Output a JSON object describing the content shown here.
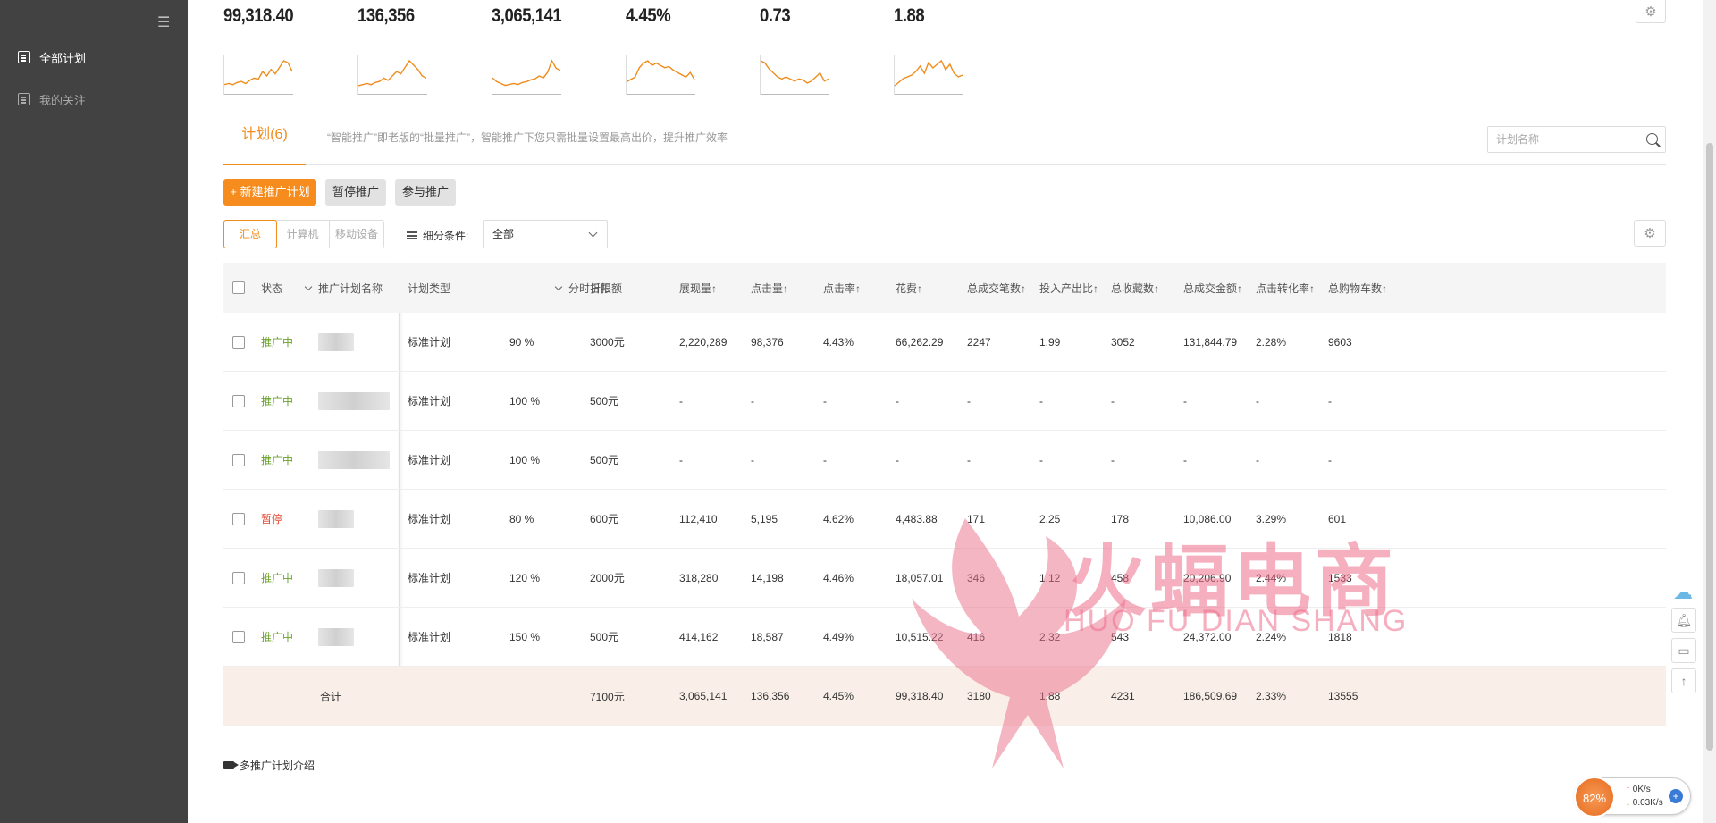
{
  "sidebar": {
    "collapse_icon": "menu-collapse-icon",
    "items": [
      {
        "label": "全部计划",
        "icon": "document-icon",
        "active": true
      },
      {
        "label": "我的关注",
        "icon": "follow-icon",
        "active": false
      }
    ]
  },
  "metrics": [
    {
      "value": "99,318.40",
      "trend": [
        6,
        7,
        6,
        8,
        9,
        7,
        10,
        12,
        11,
        18,
        14,
        20,
        16,
        22,
        28,
        26,
        18
      ]
    },
    {
      "value": "136,356",
      "trend": [
        5,
        6,
        7,
        6,
        8,
        9,
        12,
        10,
        14,
        18,
        16,
        22,
        28,
        24,
        20,
        14,
        12
      ]
    },
    {
      "value": "3,065,141",
      "trend": [
        14,
        10,
        8,
        6,
        7,
        8,
        7,
        9,
        10,
        12,
        13,
        16,
        14,
        20,
        32,
        24,
        22
      ]
    },
    {
      "value": "4.45%",
      "trend": [
        8,
        10,
        12,
        20,
        24,
        26,
        22,
        24,
        22,
        20,
        21,
        18,
        16,
        14,
        12,
        16,
        10
      ]
    },
    {
      "value": "0.73",
      "trend": [
        30,
        28,
        22,
        18,
        14,
        12,
        14,
        12,
        10,
        12,
        11,
        8,
        10,
        14,
        18,
        10,
        12
      ]
    },
    {
      "value": "1.88",
      "trend": [
        6,
        10,
        14,
        16,
        18,
        22,
        28,
        20,
        32,
        26,
        30,
        34,
        24,
        30,
        20,
        16,
        18
      ]
    }
  ],
  "tabs": {
    "active_label": "计划(6)",
    "tip": "“智能推广”即老版的“批量推广”，智能推广下您只需批量设置最高出价，提升推广效率"
  },
  "search": {
    "placeholder": "计划名称"
  },
  "toolbar": {
    "new_plan": "+ 新建推广计划",
    "pause": "暂停推广",
    "join": "参与推广"
  },
  "device_tabs": [
    "汇总",
    "计算机",
    "移动设备"
  ],
  "filter": {
    "label": "细分条件:",
    "selected": "全部"
  },
  "table": {
    "headers": {
      "status": "状态",
      "name": "推广计划名称",
      "type": "计划类型",
      "discount": "分时折扣",
      "budget": "日限额",
      "impressions": "展现量↑",
      "clicks": "点击量↑",
      "ctr": "点击率↑",
      "cost": "花费↑",
      "orders": "总成交笔数↑",
      "roi": "投入产出比↑",
      "favs": "总收藏数↑",
      "gmv": "总成交金额↑",
      "cvr": "点击转化率↑",
      "carts": "总购物车数↑"
    },
    "rows": [
      {
        "status": "推广中",
        "status_kind": "on",
        "type": "标准计划",
        "discount": "90 %",
        "budget": "3000元",
        "impressions": "2,220,289",
        "clicks": "98,376",
        "ctr": "4.43%",
        "cost": "66,262.29",
        "orders": "2247",
        "roi": "1.99",
        "favs": "3052",
        "gmv": "131,844.79",
        "cvr": "2.28%",
        "carts": "9603"
      },
      {
        "status": "推广中",
        "status_kind": "on",
        "type": "标准计划",
        "discount": "100 %",
        "budget": "500元",
        "impressions": "-",
        "clicks": "-",
        "ctr": "-",
        "cost": "-",
        "orders": "-",
        "roi": "-",
        "favs": "-",
        "gmv": "-",
        "cvr": "-",
        "carts": "-"
      },
      {
        "status": "推广中",
        "status_kind": "on",
        "type": "标准计划",
        "discount": "100 %",
        "budget": "500元",
        "impressions": "-",
        "clicks": "-",
        "ctr": "-",
        "cost": "-",
        "orders": "-",
        "roi": "-",
        "favs": "-",
        "gmv": "-",
        "cvr": "-",
        "carts": "-"
      },
      {
        "status": "暂停",
        "status_kind": "off",
        "type": "标准计划",
        "discount": "80 %",
        "budget": "600元",
        "impressions": "112,410",
        "clicks": "5,195",
        "ctr": "4.62%",
        "cost": "4,483.88",
        "orders": "171",
        "roi": "2.25",
        "favs": "178",
        "gmv": "10,086.00",
        "cvr": "3.29%",
        "carts": "601"
      },
      {
        "status": "推广中",
        "status_kind": "on",
        "type": "标准计划",
        "discount": "120 %",
        "budget": "2000元",
        "impressions": "318,280",
        "clicks": "14,198",
        "ctr": "4.46%",
        "cost": "18,057.01",
        "orders": "346",
        "roi": "1.12",
        "favs": "458",
        "gmv": "20,206.90",
        "cvr": "2.44%",
        "carts": "1533"
      },
      {
        "status": "推广中",
        "status_kind": "on",
        "type": "标准计划",
        "discount": "150 %",
        "budget": "500元",
        "impressions": "414,162",
        "clicks": "18,587",
        "ctr": "4.49%",
        "cost": "10,515.22",
        "orders": "416",
        "roi": "2.32",
        "favs": "543",
        "gmv": "24,372.00",
        "cvr": "2.24%",
        "carts": "1818"
      }
    ],
    "total": {
      "label": "合计",
      "budget": "7100元",
      "impressions": "3,065,141",
      "clicks": "136,356",
      "ctr": "4.45%",
      "cost": "99,318.40",
      "orders": "3180",
      "roi": "1.88",
      "favs": "4231",
      "gmv": "186,509.69",
      "cvr": "2.33%",
      "carts": "13555"
    }
  },
  "footer": {
    "intro_link": "多推广计划介绍"
  },
  "watermark": {
    "main": "火蝠电商",
    "sub": "HUO FU DIAN SHANG"
  },
  "net_widget": {
    "percent": "82%",
    "up": "0K/s",
    "down": "0.03K/s"
  },
  "colors": {
    "accent": "#f68b1e",
    "status_on": "#6aa22b",
    "status_off": "#e4462e",
    "sidebar_bg": "#424242"
  }
}
